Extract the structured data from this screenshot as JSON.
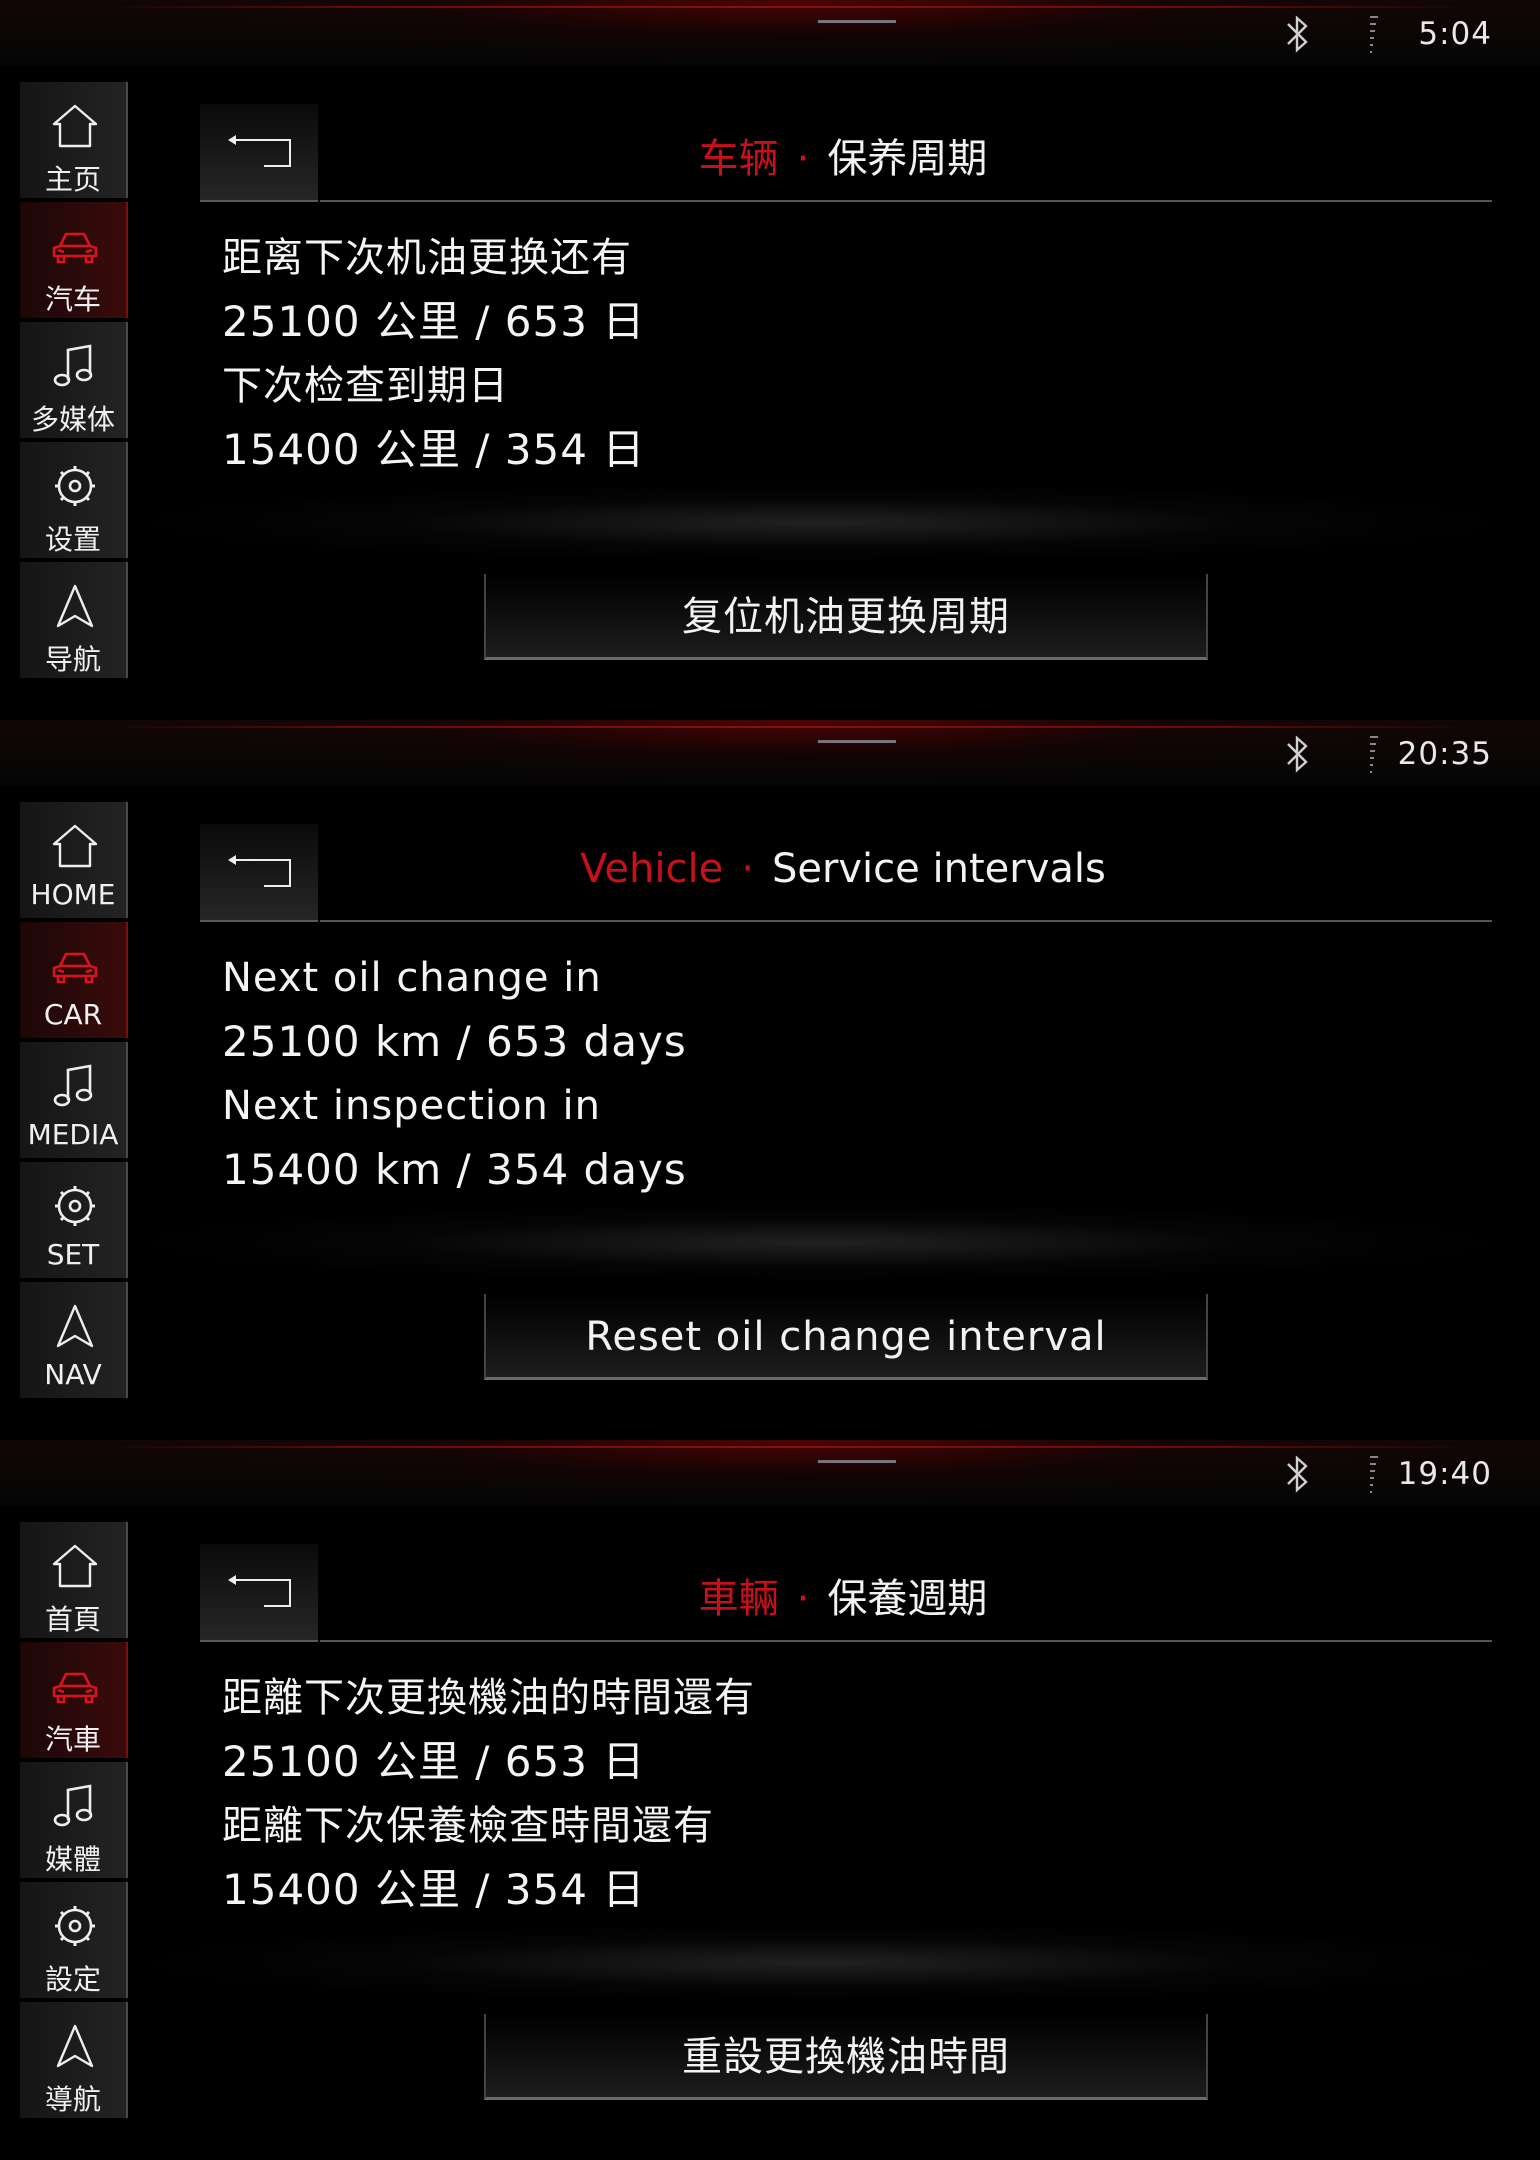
{
  "panels": [
    {
      "clock": "5:04",
      "nav": [
        {
          "icon": "home-icon",
          "label": "主页"
        },
        {
          "icon": "car-icon",
          "label": "汽车",
          "active": true
        },
        {
          "icon": "music-icon",
          "label": "多媒体"
        },
        {
          "icon": "gear-icon",
          "label": "设置"
        },
        {
          "icon": "navigation-icon",
          "label": "导航"
        }
      ],
      "breadcrumb": "车辆",
      "title": "保养周期",
      "oil_label": "距离下次机油更换还有",
      "oil_value": "25100 公里  /  653 日",
      "inspection_label": "下次检查到期日",
      "inspection_value": "15400 公里  /  354 日",
      "reset_label": "复位机油更换周期"
    },
    {
      "clock": "20:35",
      "nav": [
        {
          "icon": "home-icon",
          "label": "HOME"
        },
        {
          "icon": "car-icon",
          "label": "CAR",
          "active": true
        },
        {
          "icon": "music-icon",
          "label": "MEDIA"
        },
        {
          "icon": "gear-icon",
          "label": "SET"
        },
        {
          "icon": "navigation-icon",
          "label": "NAV"
        }
      ],
      "breadcrumb": "Vehicle",
      "title": "Service intervals",
      "oil_label": "Next oil change in",
      "oil_value": "25100 km  /  653 days",
      "inspection_label": "Next inspection in",
      "inspection_value": "15400 km  /  354 days",
      "reset_label": "Reset oil change interval"
    },
    {
      "clock": "19:40",
      "nav": [
        {
          "icon": "home-icon",
          "label": "首頁"
        },
        {
          "icon": "car-icon",
          "label": "汽車",
          "active": true
        },
        {
          "icon": "music-icon",
          "label": "媒體"
        },
        {
          "icon": "gear-icon",
          "label": "設定"
        },
        {
          "icon": "navigation-icon",
          "label": "導航"
        }
      ],
      "breadcrumb": "車輛",
      "title": "保養週期",
      "oil_label": "距離下次更換機油的時間還有",
      "oil_value": "25100 公里  /  653 日",
      "inspection_label": "距離下次保養檢查時間還有",
      "inspection_value": "15400 公里  /  354 日",
      "reset_label": "重設更換機油時間"
    }
  ],
  "colors": {
    "accent_red": "#c8101b",
    "text": "#f2f2f2",
    "background": "#000000"
  }
}
